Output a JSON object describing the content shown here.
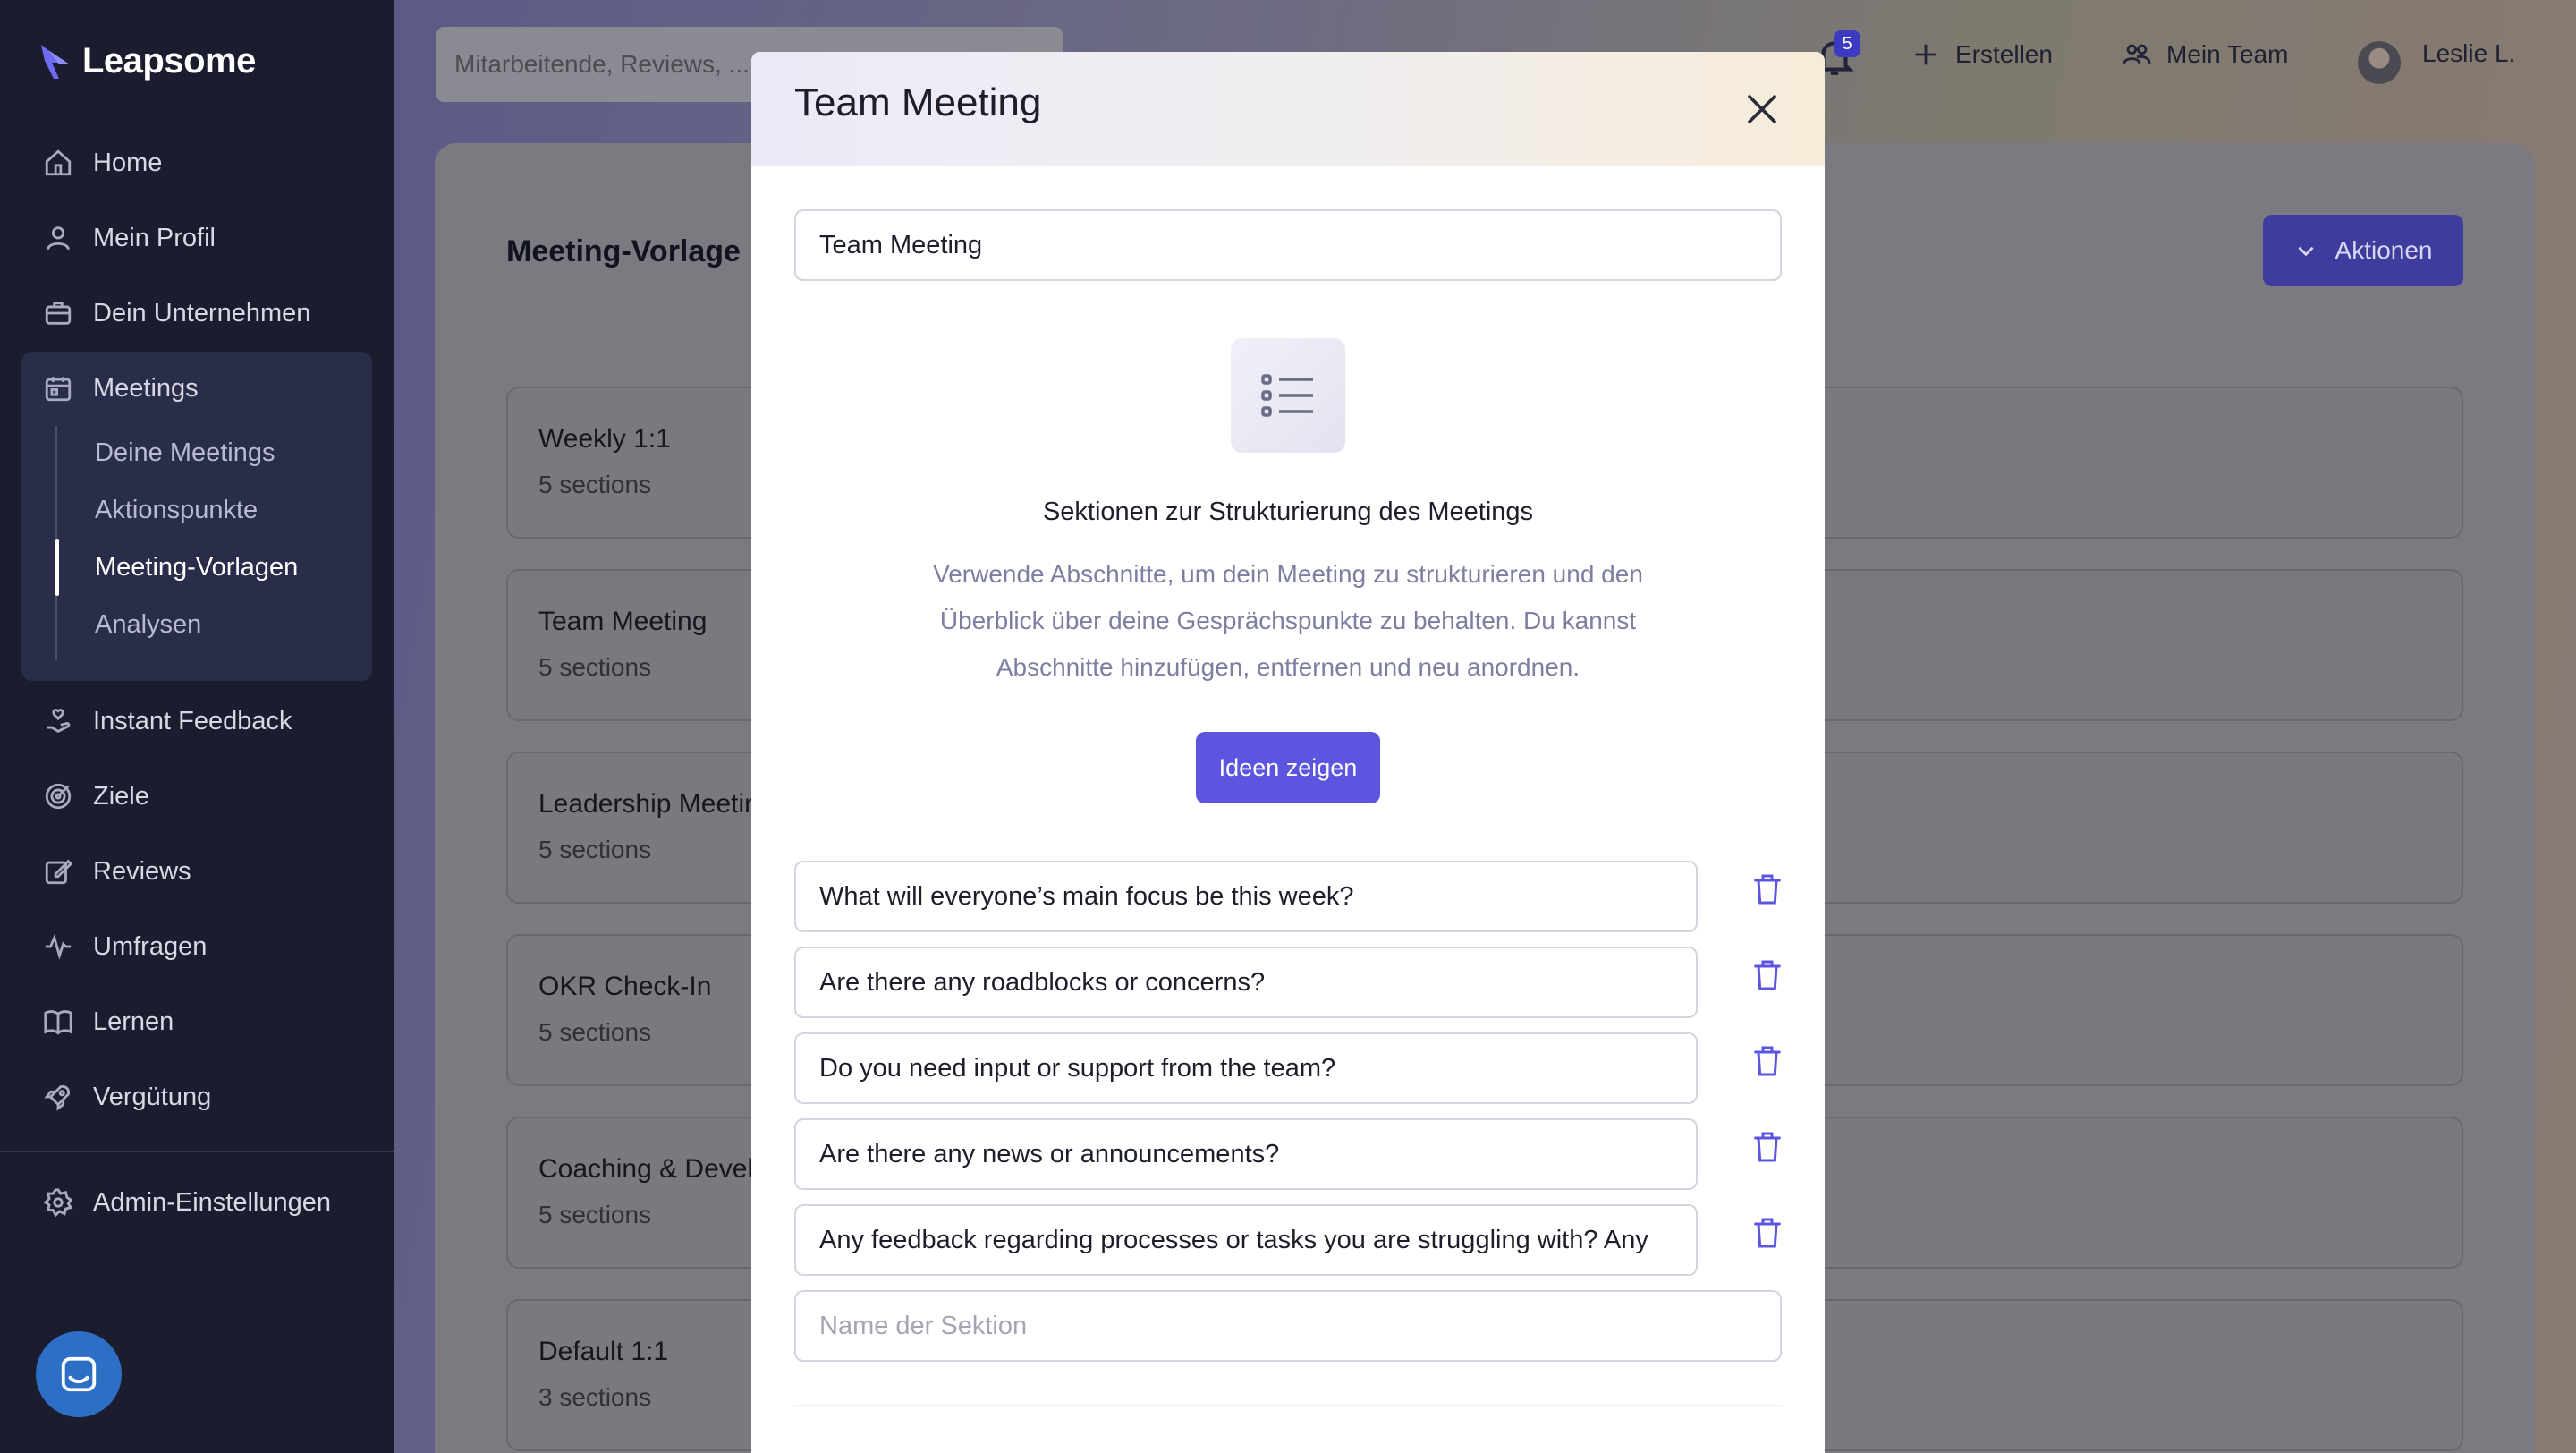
{
  "brand": {
    "name": "Leapsome"
  },
  "sidebar": {
    "items": [
      {
        "label": "Home",
        "icon": "home-icon"
      },
      {
        "label": "Mein Profil",
        "icon": "user-icon"
      },
      {
        "label": "Dein Unternehmen",
        "icon": "briefcase-icon"
      },
      {
        "label": "Meetings",
        "icon": "calendar-icon"
      },
      {
        "label": "Instant Feedback",
        "icon": "hand-heart-icon"
      },
      {
        "label": "Ziele",
        "icon": "target-icon"
      },
      {
        "label": "Reviews",
        "icon": "edit-icon"
      },
      {
        "label": "Umfragen",
        "icon": "pulse-icon"
      },
      {
        "label": "Lernen",
        "icon": "book-icon"
      },
      {
        "label": "Vergütung",
        "icon": "rocket-icon"
      },
      {
        "label": "Admin-Einstellungen",
        "icon": "gear-icon"
      }
    ],
    "meetings_sub": [
      {
        "label": "Deine Meetings"
      },
      {
        "label": "Aktionspunkte"
      },
      {
        "label": "Meeting-Vorlagen"
      },
      {
        "label": "Analysen"
      }
    ]
  },
  "topbar": {
    "search_placeholder": "Mitarbeitende, Reviews, ...",
    "notification_count": "5",
    "create_label": "Erstellen",
    "team_label": "Mein Team",
    "user_label": "Leslie L."
  },
  "page": {
    "heading": "Meeting-Vorlage",
    "actions_label": "Aktionen",
    "templates": [
      {
        "name": "Weekly 1:1",
        "sections": "5 sections"
      },
      {
        "name": "Team Meeting",
        "sections": "5 sections"
      },
      {
        "name": "Leadership Meetir",
        "sections": "5 sections"
      },
      {
        "name": "OKR Check-In",
        "sections": "5 sections"
      },
      {
        "name": "Coaching & Devel",
        "sections": "5 sections"
      },
      {
        "name": "Default 1:1",
        "sections": "3 sections"
      }
    ]
  },
  "modal": {
    "title": "Team Meeting",
    "name_value": "Team Meeting",
    "sections_heading": "Sektionen zur Strukturierung des Meetings",
    "sections_desc": "Verwende Abschnitte, um dein Meeting zu strukturieren und den Überblick über deine Gesprächspunkte zu behalten. Du kannst Abschnitte hinzufügen, entfernen und neu anordnen.",
    "ideas_label": "Ideen zeigen",
    "sections": [
      "What will everyone’s main focus be this week?",
      "Are there any roadblocks or concerns?",
      "Do you need input or support from the team?",
      "Are there any news or announcements?",
      "Any feedback regarding processes or tasks you are struggling with? Any"
    ],
    "new_section_placeholder": "Name der Sektion"
  },
  "colors": {
    "sidebar_bg": "#1b1d2e",
    "accent": "#5b55e0",
    "trash_icon": "#5b55e0"
  }
}
